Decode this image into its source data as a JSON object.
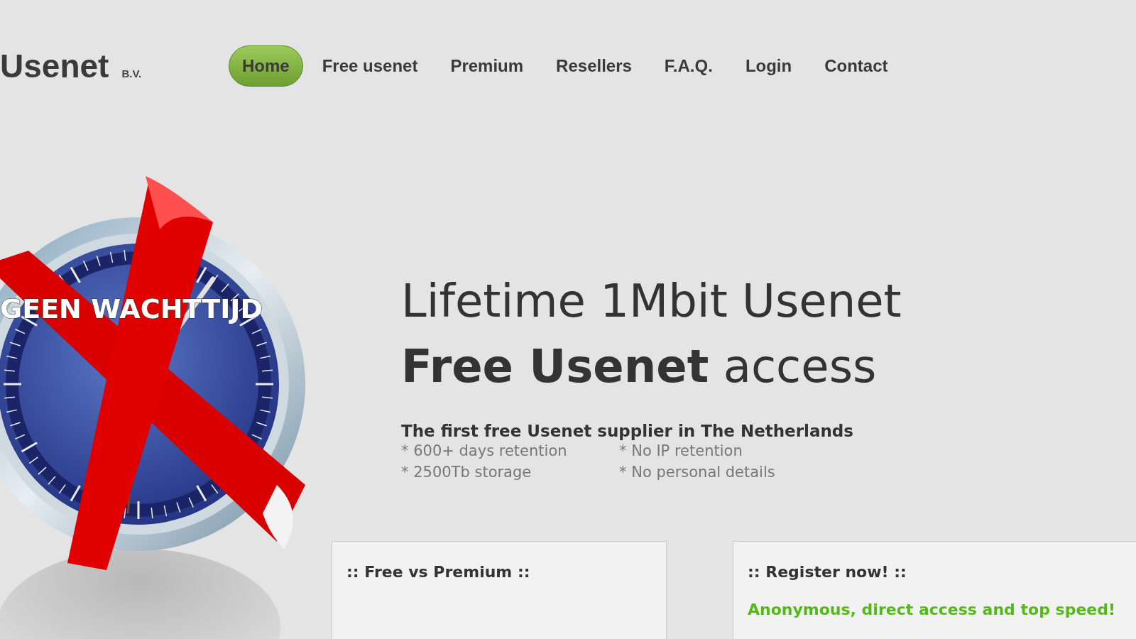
{
  "logo": {
    "name": "Usenet",
    "suffix": "B.V."
  },
  "nav": [
    {
      "label": "Home",
      "selected": true
    },
    {
      "label": "Free usenet",
      "selected": false
    },
    {
      "label": "Premium",
      "selected": false
    },
    {
      "label": "Resellers",
      "selected": false
    },
    {
      "label": "F.A.Q.",
      "selected": false
    },
    {
      "label": "Login",
      "selected": false
    },
    {
      "label": "Contact",
      "selected": false
    }
  ],
  "hero_image": {
    "caption": "GEEN WACHTTIJD"
  },
  "hero": {
    "title_line_1": "Lifetime 1Mbit Usenet",
    "title_line_2": "**Free Usenet** access",
    "subtitle": "The first free Usenet supplier in The Netherlands",
    "features": [
      "* 600+ days retention",
      "* No IP retention",
      "* 2500Tb storage",
      "* No personal details"
    ]
  },
  "cards": [
    {
      "title": ":: Free vs Premium ::"
    },
    {
      "title": ":: Register now! ::",
      "tagline": "Anonymous, direct access and top speed!"
    }
  ]
}
